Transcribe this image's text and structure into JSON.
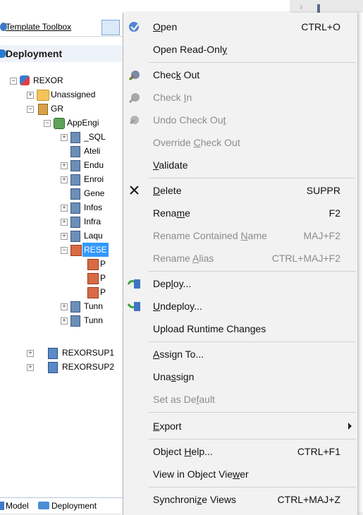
{
  "panel": {
    "toolbox_label": "Template Toolbox",
    "deployment_title": "Deployment",
    "bottom_tab_model": "Model",
    "bottom_tab_deployment": "Deployment"
  },
  "tree": [
    {
      "label": "REXOR",
      "icon": "root-icon"
    },
    {
      "label": "Unassigned",
      "icon": "folder-icon"
    },
    {
      "label": "GR",
      "icon": "server-icon"
    },
    {
      "label": "AppEngi",
      "icon": "app-engine-icon"
    },
    {
      "label": "_SQL",
      "icon": "component-icon"
    },
    {
      "label": "Ateli",
      "icon": "component-icon"
    },
    {
      "label": "Endu",
      "icon": "component-icon"
    },
    {
      "label": "Enroi",
      "icon": "component-icon"
    },
    {
      "label": "Gene",
      "icon": "component-icon"
    },
    {
      "label": "Infos",
      "icon": "component-icon"
    },
    {
      "label": "Infra",
      "icon": "component-icon"
    },
    {
      "label": "Laqu",
      "icon": "component-icon"
    },
    {
      "label": "RESE",
      "icon": "reservation-icon"
    },
    {
      "label": "P",
      "icon": "reservation-icon"
    },
    {
      "label": "P",
      "icon": "reservation-icon"
    },
    {
      "label": "P",
      "icon": "reservation-icon"
    },
    {
      "label": "Tunn",
      "icon": "component-icon"
    },
    {
      "label": "Tunn",
      "icon": "component-icon"
    },
    {
      "label": "REXORSUP1",
      "icon": "sup-icon"
    },
    {
      "label": "REXORSUP2",
      "icon": "sup-icon"
    }
  ],
  "menu": {
    "items": [
      {
        "pre": "",
        "u": "O",
        "post": "pen",
        "shortcut": "CTRL+O",
        "disabled": false
      },
      {
        "pre": "Open Read-Onl",
        "u": "y",
        "post": "",
        "shortcut": "",
        "disabled": false
      },
      {
        "pre": "Chec",
        "u": "k",
        "post": " Out",
        "shortcut": "",
        "disabled": false
      },
      {
        "pre": "Check ",
        "u": "I",
        "post": "n",
        "shortcut": "",
        "disabled": true
      },
      {
        "pre": "Undo Check Ou",
        "u": "t",
        "post": "",
        "shortcut": "",
        "disabled": true
      },
      {
        "pre": "Override ",
        "u": "C",
        "post": "heck Out",
        "shortcut": "",
        "disabled": true
      },
      {
        "pre": "",
        "u": "V",
        "post": "alidate",
        "shortcut": "",
        "disabled": false
      },
      {
        "pre": "",
        "u": "D",
        "post": "elete",
        "shortcut": "SUPPR",
        "disabled": false
      },
      {
        "pre": "Rena",
        "u": "m",
        "post": "e",
        "shortcut": "F2",
        "disabled": false
      },
      {
        "pre": "Rename Contained ",
        "u": "N",
        "post": "ame",
        "shortcut": "MAJ+F2",
        "disabled": true
      },
      {
        "pre": "Rename ",
        "u": "A",
        "post": "lias",
        "shortcut": "CTRL+MAJ+F2",
        "disabled": true
      },
      {
        "pre": "Dep",
        "u": "l",
        "post": "oy...",
        "shortcut": "",
        "disabled": false
      },
      {
        "pre": "",
        "u": "U",
        "post": "ndeploy...",
        "shortcut": "",
        "disabled": false
      },
      {
        "pre": "Upload Runtime Chan",
        "u": "g",
        "post": "es",
        "shortcut": "",
        "disabled": false
      },
      {
        "pre": "",
        "u": "A",
        "post": "ssign To...",
        "shortcut": "",
        "disabled": false
      },
      {
        "pre": "Una",
        "u": "s",
        "post": "sign",
        "shortcut": "",
        "disabled": false
      },
      {
        "pre": "Set as De",
        "u": "f",
        "post": "ault",
        "shortcut": "",
        "disabled": true
      },
      {
        "pre": "",
        "u": "E",
        "post": "xport",
        "shortcut": "",
        "disabled": false
      },
      {
        "pre": "Object ",
        "u": "H",
        "post": "elp...",
        "shortcut": "CTRL+F1",
        "disabled": false
      },
      {
        "pre": "View in Object Vie",
        "u": "w",
        "post": "er",
        "shortcut": "",
        "disabled": false
      },
      {
        "pre": "Synchroni",
        "u": "z",
        "post": "e Views",
        "shortcut": "CTRL+MAJ+Z",
        "disabled": false
      }
    ]
  }
}
